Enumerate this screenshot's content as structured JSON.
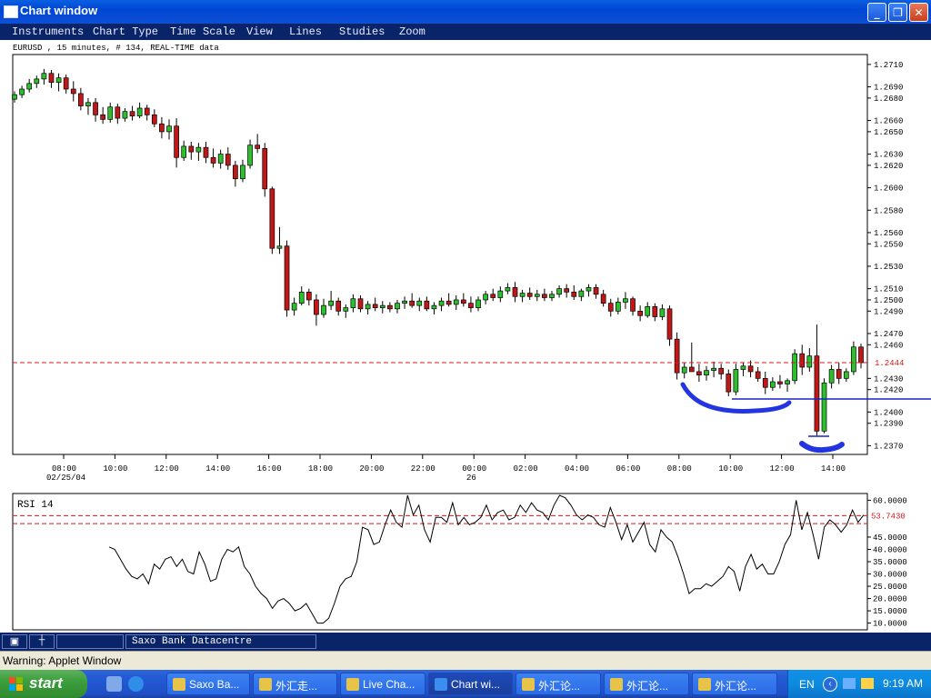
{
  "window": {
    "title": "Chart window",
    "min_icon": "minimize-icon",
    "max_icon": "restore-icon",
    "close_icon": "close-icon"
  },
  "menu": [
    "Instruments",
    "Chart Type",
    "Time Scale",
    "View",
    "Lines",
    "Studies",
    "Zoom"
  ],
  "price_chart": {
    "header": "EURUSD , 15 minutes, # 134, REAL-TIME data",
    "y_ticks": [
      "1.2710",
      "1.2690",
      "1.2680",
      "1.2660",
      "1.2650",
      "1.2630",
      "1.2620",
      "1.2600",
      "1.2580",
      "1.2560",
      "1.2550",
      "1.2530",
      "1.2510",
      "1.2500",
      "1.2490",
      "1.2470",
      "1.2460",
      "1.2430",
      "1.2420",
      "1.2400",
      "1.2390",
      "1.2370"
    ],
    "current_price": "1.2444",
    "x_ticks": [
      "08:00",
      "10:00",
      "12:00",
      "14:00",
      "16:00",
      "18:00",
      "20:00",
      "22:00",
      "00:00",
      "02:00",
      "04:00",
      "06:00",
      "08:00",
      "10:00",
      "12:00",
      "14:00"
    ],
    "date_labels": [
      "02/25/04",
      "26"
    ]
  },
  "rsi_chart": {
    "title": "RSI 14",
    "y_ticks": [
      "60.0000",
      "45.0000",
      "40.0000",
      "35.0000",
      "30.0000",
      "25.0000",
      "20.0000",
      "15.0000",
      "10.0000"
    ],
    "current_value": "53.7430"
  },
  "status": {
    "source": "Saxo Bank Datacentre",
    "btn_icons": [
      "tool-icon",
      "crosshair-icon"
    ]
  },
  "warning": "Warning: Applet Window",
  "taskbar": {
    "start": "start",
    "tasks": [
      {
        "label": "Saxo Ba...",
        "icon": "app-icon",
        "active": false
      },
      {
        "label": "外汇走...",
        "icon": "app-icon",
        "active": false
      },
      {
        "label": "Live Cha...",
        "icon": "app-icon",
        "active": false
      },
      {
        "label": "Chart wi...",
        "icon": "ie-icon",
        "active": true
      },
      {
        "label": "外汇论...",
        "icon": "app-icon",
        "active": false
      },
      {
        "label": "外汇论...",
        "icon": "app-icon",
        "active": false
      },
      {
        "label": "外汇论...",
        "icon": "app-icon",
        "active": false
      }
    ],
    "lang": "EN",
    "clock": "9:19 AM"
  },
  "chart_data": [
    {
      "type": "candlestick",
      "title": "EURUSD , 15 minutes, # 134, REAL-TIME data",
      "ylim": [
        1.2363,
        1.2718
      ],
      "series": [
        {
          "name": "EURUSD",
          "ohlc": [
            [
              1.2679,
              1.2686,
              1.2676,
              1.2683
            ],
            [
              1.2683,
              1.2691,
              1.268,
              1.2688
            ],
            [
              1.2688,
              1.2697,
              1.2685,
              1.2693
            ],
            [
              1.2693,
              1.27,
              1.2689,
              1.2697
            ],
            [
              1.2697,
              1.2706,
              1.2692,
              1.2702
            ],
            [
              1.2702,
              1.2705,
              1.2689,
              1.2694
            ],
            [
              1.2694,
              1.2702,
              1.2686,
              1.2698
            ],
            [
              1.2698,
              1.2701,
              1.2684,
              1.2688
            ],
            [
              1.2688,
              1.2695,
              1.2677,
              1.2684
            ],
            [
              1.2684,
              1.2689,
              1.2669,
              1.2673
            ],
            [
              1.2673,
              1.268,
              1.2665,
              1.2676
            ],
            [
              1.2676,
              1.268,
              1.2659,
              1.2665
            ],
            [
              1.2665,
              1.2672,
              1.2657,
              1.2661
            ],
            [
              1.2661,
              1.2676,
              1.2658,
              1.2672
            ],
            [
              1.2672,
              1.2675,
              1.2657,
              1.2662
            ],
            [
              1.2662,
              1.2671,
              1.2659,
              1.2668
            ],
            [
              1.2668,
              1.2673,
              1.266,
              1.2664
            ],
            [
              1.2664,
              1.2676,
              1.2662,
              1.2671
            ],
            [
              1.2671,
              1.2674,
              1.266,
              1.2665
            ],
            [
              1.2665,
              1.267,
              1.2654,
              1.2657
            ],
            [
              1.2657,
              1.2663,
              1.2644,
              1.265
            ],
            [
              1.265,
              1.2661,
              1.2643,
              1.2655
            ],
            [
              1.2655,
              1.2662,
              1.2618,
              1.2627
            ],
            [
              1.2627,
              1.2642,
              1.2624,
              1.2637
            ],
            [
              1.2637,
              1.2641,
              1.2625,
              1.2632
            ],
            [
              1.2632,
              1.264,
              1.2624,
              1.2636
            ],
            [
              1.2636,
              1.2641,
              1.2622,
              1.2627
            ],
            [
              1.2627,
              1.2635,
              1.2618,
              1.2622
            ],
            [
              1.2622,
              1.2634,
              1.2617,
              1.263
            ],
            [
              1.263,
              1.2636,
              1.2616,
              1.262
            ],
            [
              1.262,
              1.2624,
              1.2601,
              1.2608
            ],
            [
              1.2608,
              1.2625,
              1.2605,
              1.262
            ],
            [
              1.262,
              1.2643,
              1.2617,
              1.2638
            ],
            [
              1.2638,
              1.2648,
              1.2631,
              1.2635
            ],
            [
              1.2635,
              1.264,
              1.2592,
              1.2599
            ],
            [
              1.2599,
              1.2601,
              1.2541,
              1.2546
            ],
            [
              1.2546,
              1.2565,
              1.2541,
              1.2548
            ],
            [
              1.2548,
              1.2553,
              1.2485,
              1.2491
            ],
            [
              1.2491,
              1.2502,
              1.2486,
              1.2497
            ],
            [
              1.2497,
              1.2512,
              1.2495,
              1.2507
            ],
            [
              1.2507,
              1.251,
              1.2495,
              1.25
            ],
            [
              1.25,
              1.2505,
              1.2477,
              1.2487
            ],
            [
              1.2487,
              1.2501,
              1.2484,
              1.2495
            ],
            [
              1.2495,
              1.2508,
              1.2491,
              1.2499
            ],
            [
              1.2499,
              1.2502,
              1.2486,
              1.249
            ],
            [
              1.249,
              1.2496,
              1.2484,
              1.2493
            ],
            [
              1.2493,
              1.2505,
              1.2489,
              1.2501
            ],
            [
              1.2501,
              1.2504,
              1.2489,
              1.2492
            ],
            [
              1.2492,
              1.2499,
              1.2487,
              1.2496
            ],
            [
              1.2496,
              1.2502,
              1.249,
              1.2493
            ],
            [
              1.2493,
              1.2499,
              1.2488,
              1.2495
            ],
            [
              1.2495,
              1.2498,
              1.2489,
              1.2492
            ],
            [
              1.2492,
              1.25,
              1.2488,
              1.2497
            ],
            [
              1.2497,
              1.2503,
              1.2492,
              1.2499
            ],
            [
              1.2499,
              1.2506,
              1.2493,
              1.2495
            ],
            [
              1.2495,
              1.2502,
              1.249,
              1.2499
            ],
            [
              1.2499,
              1.2503,
              1.249,
              1.2492
            ],
            [
              1.2492,
              1.2498,
              1.2487,
              1.2495
            ],
            [
              1.2495,
              1.2502,
              1.249,
              1.2499
            ],
            [
              1.2499,
              1.2506,
              1.2494,
              1.2496
            ],
            [
              1.2496,
              1.2504,
              1.2491,
              1.25
            ],
            [
              1.25,
              1.2506,
              1.2494,
              1.2497
            ],
            [
              1.2497,
              1.2503,
              1.2489,
              1.2493
            ],
            [
              1.2493,
              1.2503,
              1.249,
              1.25
            ],
            [
              1.25,
              1.2508,
              1.2496,
              1.2505
            ],
            [
              1.2505,
              1.251,
              1.2499,
              1.2502
            ],
            [
              1.2502,
              1.2512,
              1.2498,
              1.2508
            ],
            [
              1.2508,
              1.2515,
              1.2505,
              1.2511
            ],
            [
              1.2511,
              1.2516,
              1.2498,
              1.2503
            ],
            [
              1.2503,
              1.2509,
              1.2498,
              1.2506
            ],
            [
              1.2506,
              1.2511,
              1.25,
              1.2503
            ],
            [
              1.2503,
              1.2509,
              1.2499,
              1.2505
            ],
            [
              1.2505,
              1.251,
              1.2499,
              1.2502
            ],
            [
              1.2502,
              1.2508,
              1.2499,
              1.2505
            ],
            [
              1.2505,
              1.2513,
              1.2502,
              1.251
            ],
            [
              1.251,
              1.2514,
              1.2502,
              1.2507
            ],
            [
              1.2507,
              1.2513,
              1.25,
              1.2503
            ],
            [
              1.2503,
              1.251,
              1.2499,
              1.2508
            ],
            [
              1.2508,
              1.2514,
              1.2503,
              1.2511
            ],
            [
              1.2511,
              1.2514,
              1.2501,
              1.2505
            ],
            [
              1.2505,
              1.2509,
              1.2494,
              1.2497
            ],
            [
              1.2497,
              1.2501,
              1.2485,
              1.249
            ],
            [
              1.249,
              1.2502,
              1.2487,
              1.2498
            ],
            [
              1.2498,
              1.2507,
              1.2492,
              1.2501
            ],
            [
              1.2501,
              1.2503,
              1.2486,
              1.249
            ],
            [
              1.249,
              1.2495,
              1.2481,
              1.2486
            ],
            [
              1.2486,
              1.2498,
              1.2484,
              1.2494
            ],
            [
              1.2494,
              1.2497,
              1.2481,
              1.2485
            ],
            [
              1.2485,
              1.2496,
              1.2482,
              1.2492
            ],
            [
              1.2492,
              1.2495,
              1.2459,
              1.2465
            ],
            [
              1.2465,
              1.2471,
              1.2429,
              1.2435
            ],
            [
              1.2435,
              1.2444,
              1.243,
              1.244
            ],
            [
              1.244,
              1.2462,
              1.2437,
              1.2436
            ],
            [
              1.2436,
              1.2443,
              1.2427,
              1.2433
            ],
            [
              1.2433,
              1.2441,
              1.2428,
              1.2437
            ],
            [
              1.2437,
              1.2445,
              1.2431,
              1.2439
            ],
            [
              1.2439,
              1.2443,
              1.2429,
              1.2434
            ],
            [
              1.2434,
              1.2438,
              1.2414,
              1.2418
            ],
            [
              1.2418,
              1.2443,
              1.2415,
              1.2438
            ],
            [
              1.2438,
              1.2444,
              1.2432,
              1.2441
            ],
            [
              1.2441,
              1.2446,
              1.2431,
              1.2436
            ],
            [
              1.2436,
              1.244,
              1.2427,
              1.243
            ],
            [
              1.243,
              1.2436,
              1.2416,
              1.2422
            ],
            [
              1.2422,
              1.2431,
              1.2419,
              1.2427
            ],
            [
              1.2427,
              1.2433,
              1.2421,
              1.2425
            ],
            [
              1.2425,
              1.243,
              1.2418,
              1.2428
            ],
            [
              1.2428,
              1.2456,
              1.2425,
              1.2452
            ],
            [
              1.2452,
              1.246,
              1.2433,
              1.244
            ],
            [
              1.244,
              1.2457,
              1.2436,
              1.245
            ],
            [
              1.245,
              1.2478,
              1.2379,
              1.2383
            ],
            [
              1.2383,
              1.243,
              1.2381,
              1.2426
            ],
            [
              1.2426,
              1.2442,
              1.2421,
              1.2438
            ],
            [
              1.2438,
              1.2444,
              1.2425,
              1.243
            ],
            [
              1.243,
              1.2439,
              1.2427,
              1.2436
            ],
            [
              1.2436,
              1.2463,
              1.2433,
              1.2458
            ],
            [
              1.2458,
              1.2461,
              1.2439,
              1.2444
            ]
          ]
        }
      ],
      "current_price": 1.2444,
      "x_ticks": [
        "08:00",
        "10:00",
        "12:00",
        "14:00",
        "16:00",
        "18:00",
        "20:00",
        "22:00",
        "00:00",
        "02:00",
        "04:00",
        "06:00",
        "08:00",
        "10:00",
        "12:00",
        "14:00"
      ]
    },
    {
      "type": "line",
      "title": "RSI 14",
      "ylim": [
        8,
        62
      ],
      "levels": [
        53.743,
        50.5
      ],
      "series": [
        {
          "name": "RSI 14",
          "values": [
            41,
            40,
            36,
            32,
            29,
            28,
            30,
            26,
            34,
            32,
            36,
            37,
            33,
            36,
            31,
            30,
            39,
            34,
            27,
            28,
            36,
            40,
            39,
            41,
            33,
            30,
            25,
            22,
            20,
            16,
            19,
            20,
            18,
            15,
            16,
            18,
            14,
            10,
            10,
            12,
            18,
            25,
            28,
            29,
            35,
            49,
            48,
            42,
            43,
            50,
            56,
            51,
            49,
            62,
            54,
            58,
            48,
            43,
            53,
            53,
            51,
            59,
            50,
            53,
            50,
            51,
            53,
            58,
            52,
            55,
            56,
            52,
            53,
            58,
            55,
            59,
            56,
            55,
            52,
            58,
            62,
            61,
            58,
            54,
            52,
            54,
            53,
            50,
            49,
            57,
            51,
            44,
            50,
            43,
            47,
            51,
            42,
            39,
            48,
            45,
            43,
            37,
            30,
            22,
            24,
            24,
            26,
            25,
            27,
            29,
            33,
            31,
            23,
            33,
            38,
            32,
            34,
            30,
            30,
            35,
            42,
            46,
            60,
            48,
            55,
            46,
            36,
            49,
            52,
            50,
            47,
            50,
            56,
            51,
            54
          ]
        }
      ]
    }
  ]
}
